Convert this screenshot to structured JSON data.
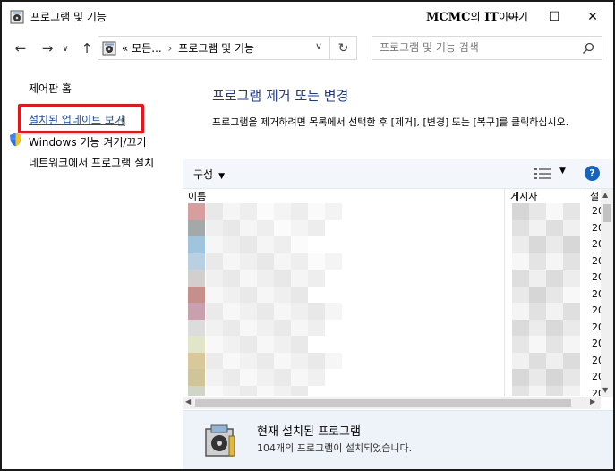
{
  "window": {
    "title": "프로그램 및 기능",
    "watermark_brand": "MCMC",
    "watermark_join": "의",
    "watermark_it": "IT",
    "watermark_tail": "이야기"
  },
  "titlebar": {
    "min": "—",
    "max": "☐",
    "close": "✕"
  },
  "nav": {
    "back": "←",
    "forward": "→",
    "recent": "∨",
    "up": "↑",
    "address_overflow": "«",
    "address_parent": "모든...",
    "address_sep": "›",
    "address_current": "프로그램 및 기능",
    "address_dropdown": "∨",
    "refresh": "↻"
  },
  "search": {
    "placeholder": "프로그램 및 기능 검색"
  },
  "left_pane": {
    "home": "제어판 홈",
    "installed_updates": "설치된 업데이트 보기",
    "windows_features": "Windows 기능 켜기/끄기",
    "network_install": "네트워크에서 프로그램 설치"
  },
  "main": {
    "heading": "프로그램 제거 또는 변경",
    "description": "프로그램을 제거하려면 목록에서 선택한 후 [제거], [변경] 또는 [복구]를 클릭하십시오."
  },
  "toolbar": {
    "organize": "구성",
    "help": "?"
  },
  "list": {
    "columns": [
      "이름",
      "게시자",
      "설"
    ],
    "installed_prefix": [
      "20",
      "20",
      "20",
      "20",
      "20",
      "20",
      "20",
      "20",
      "20",
      "20",
      "20",
      "20"
    ]
  },
  "status": {
    "title": "현재 설치된 프로그램",
    "subtitle": "104개의 프로그램이 설치되었습니다."
  },
  "colors": {
    "link": "#1a4fa0",
    "heading": "#1e3a8a",
    "highlight_box": "#e8141a",
    "toolbar_bg": "#f3f6fa",
    "status_bg": "#eef3f9"
  }
}
